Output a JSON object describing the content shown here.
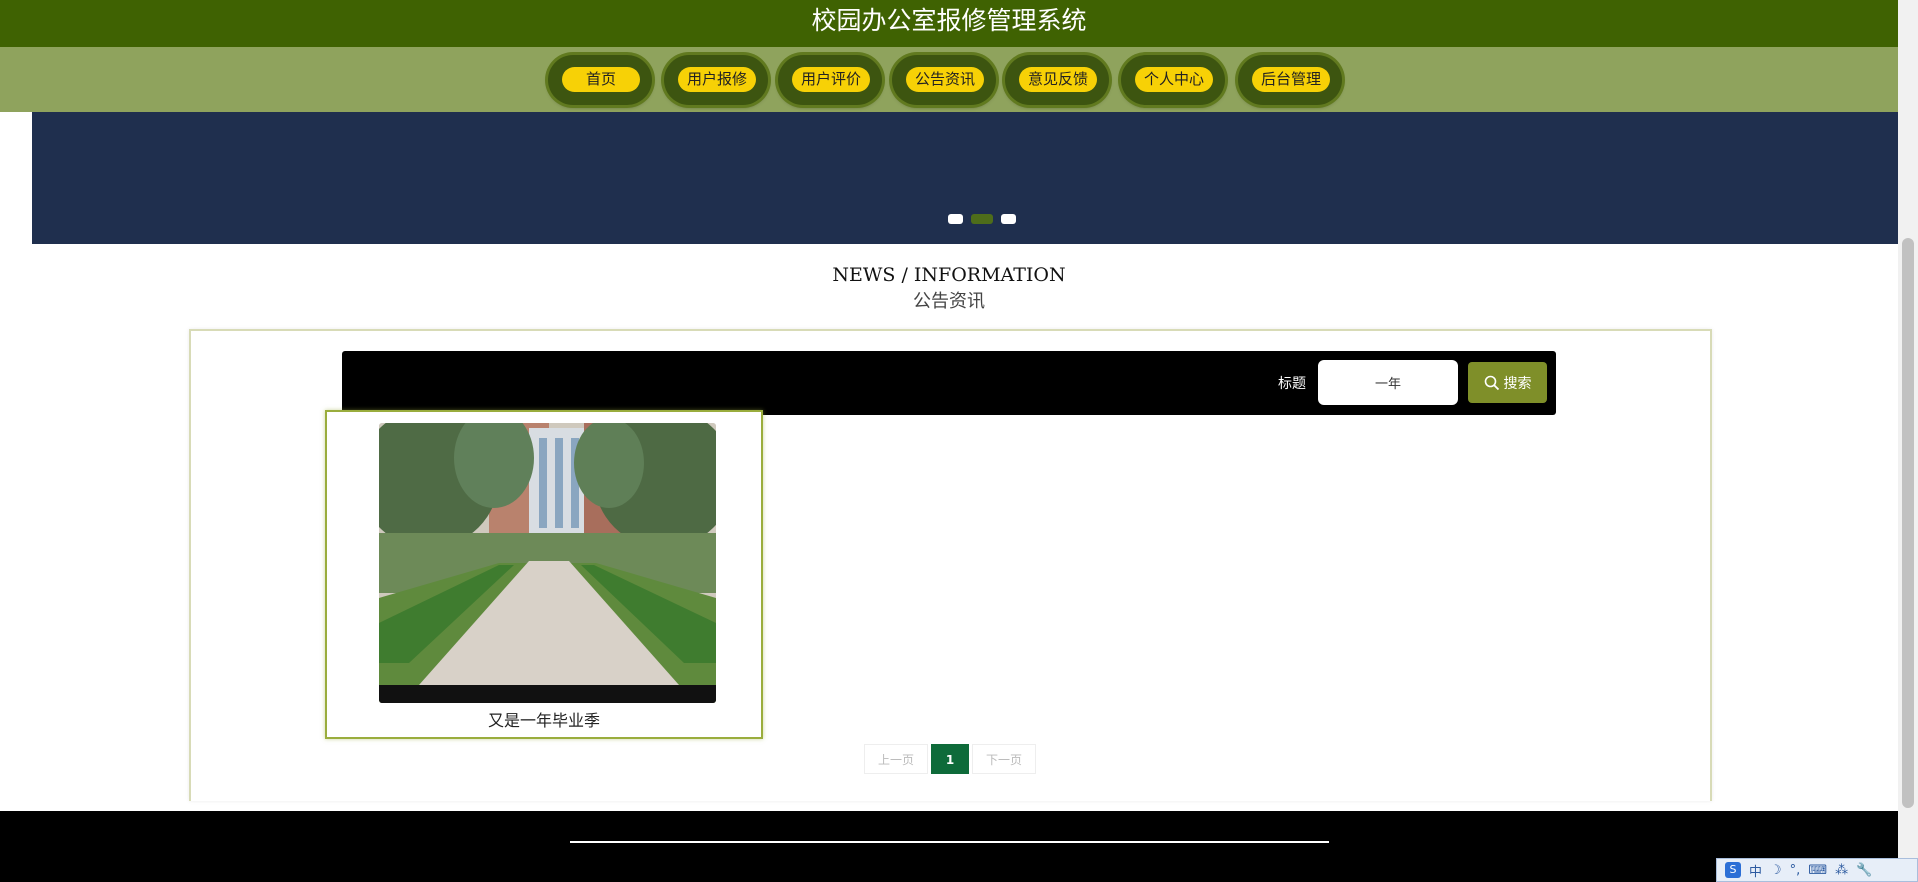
{
  "header": {
    "title": "校园办公室报修管理系统"
  },
  "nav": {
    "items": [
      {
        "label": "首页"
      },
      {
        "label": "用户报修"
      },
      {
        "label": "用户评价"
      },
      {
        "label": "公告资讯"
      },
      {
        "label": "意见反馈"
      },
      {
        "label": "个人中心"
      },
      {
        "label": "后台管理"
      }
    ]
  },
  "banner": {
    "slide_count": 3,
    "active_slide": 2
  },
  "section": {
    "title_en": "NEWS / INFORMATION",
    "title_cn": "公告资讯"
  },
  "search": {
    "label": "标题",
    "value": "一年",
    "button_label": "搜索",
    "button_icon": "search-icon"
  },
  "cards": [
    {
      "title": "又是一年毕业季"
    }
  ],
  "pager": {
    "prev_label": "上一页",
    "current_page": "1",
    "next_label": "下一页"
  },
  "ime": {
    "mode": "中",
    "indicators": [
      "☽",
      "°,",
      "⌨",
      "⁂",
      "🔧"
    ]
  },
  "colors": {
    "header_bg": "#3f6202",
    "nav_bg": "#8fa35d",
    "nav_pill": "#f7d106",
    "banner_bg": "#1f2f4e",
    "search_button": "#7f8f29",
    "page_active": "#0e6b3a"
  }
}
